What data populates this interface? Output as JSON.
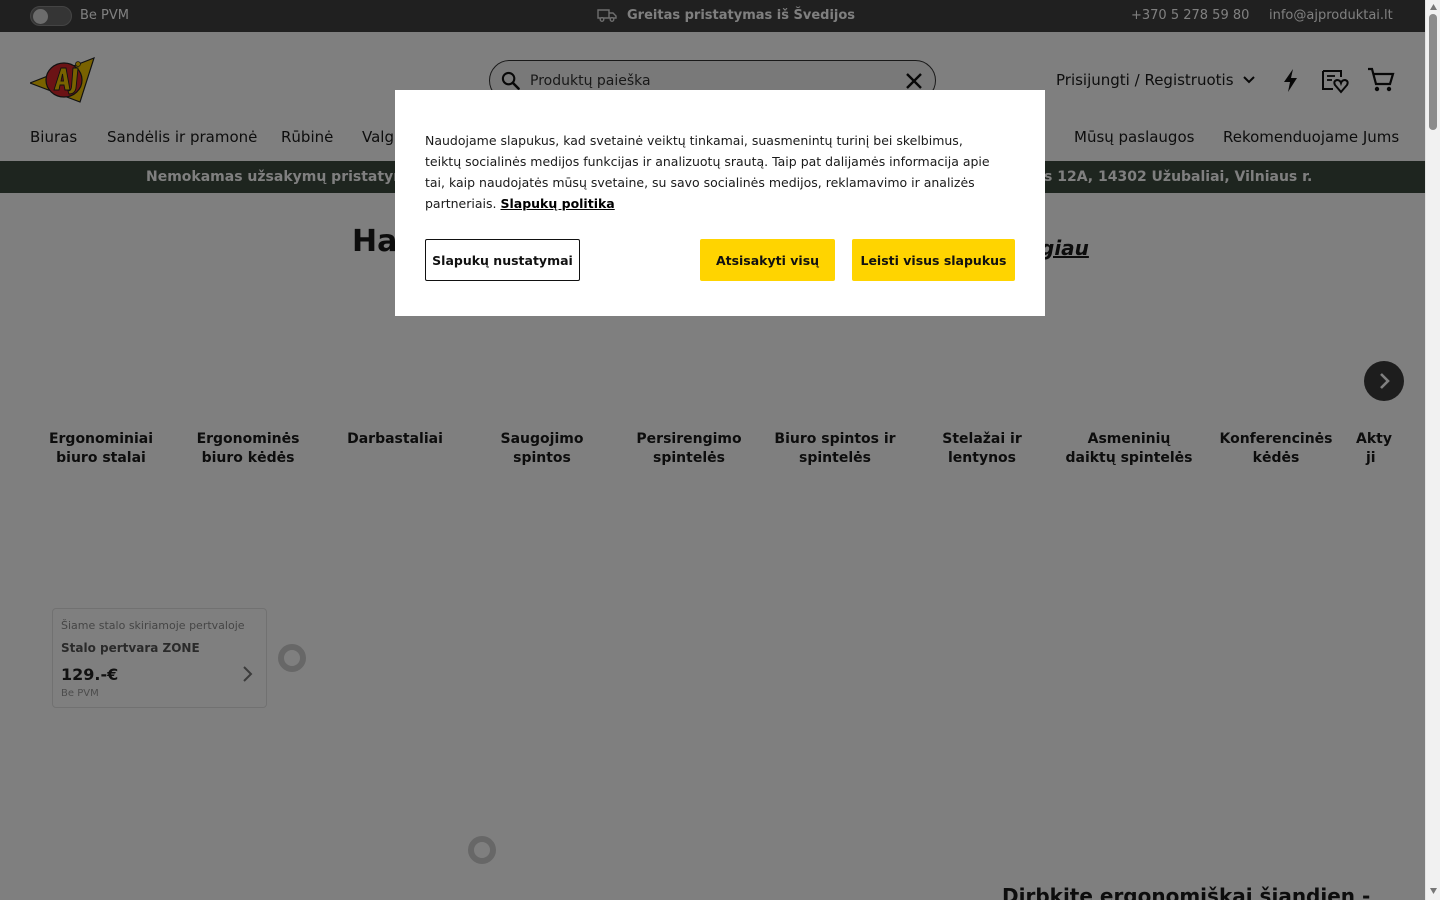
{
  "topbar": {
    "vat_toggle_label": "Be PVM",
    "shipping_text": "Greitas pristatymas iš Švedijos",
    "phone": "+370 5 278 59 80",
    "email": "info@ajproduktai.lt"
  },
  "header": {
    "search_placeholder": "Produktų paieška",
    "login_label": "Prisijungti / Registruotis"
  },
  "nav": {
    "items": [
      "Biuras",
      "Sandėlis ir pramonė",
      "Rūbinė",
      "Valg",
      "Mūsų paslaugos",
      "Rekomenduojame Jums"
    ]
  },
  "promo": {
    "left": "Nemokamas užsakymų pristatyma",
    "right": "s 12A, 14302 Užubaliai, Vilniaus r."
  },
  "section": {
    "heading_left": "Ha",
    "heading_right": "giau"
  },
  "categories": [
    [
      "Ergonominiai",
      "biuro stalai"
    ],
    [
      "Ergonominės",
      "biuro kėdės"
    ],
    [
      "Darbastaliai",
      ""
    ],
    [
      "Saugojimo",
      "spintos"
    ],
    [
      "Persirengimo",
      "spintelės"
    ],
    [
      "Biuro spintos ir",
      "spintelės"
    ],
    [
      "Stelažai ir",
      "lentynos"
    ],
    [
      "Asmeninių",
      "daiktų spintelės"
    ],
    [
      "Konferencinės",
      "kėdės"
    ],
    [
      "Akty",
      "ji"
    ]
  ],
  "product": {
    "caption": "Šiame stalo skiriamoje pertvaloje",
    "name": "Stalo pertvara ZONE",
    "price": "129.-€",
    "price_note": "Be PVM"
  },
  "bottom_heading": "Dirbkite ergonomiškai šiandien -",
  "cookie": {
    "text": "Naudojame slapukus, kad svetainė veiktų tinkamai, suasmenintų turinį bei skelbimus, teiktų socialinės medijos funkcijas ir analizuotų srautą. Taip pat dalijamės informacija apie tai, kaip naudojatės mūsų svetaine, su savo socialinės medijos, reklamavimo ir analizės partneriais.",
    "policy_link": "Slapukų politika",
    "settings_button": "Slapukų nustatymai",
    "reject_button": "Atsisakyti visų",
    "accept_button": "Leisti visus slapukus"
  },
  "colors": {
    "accent_yellow": "#ffd400",
    "topbar_bg": "#404040",
    "promo_bg": "#3d4a3e",
    "logo_red": "#d7262b"
  }
}
